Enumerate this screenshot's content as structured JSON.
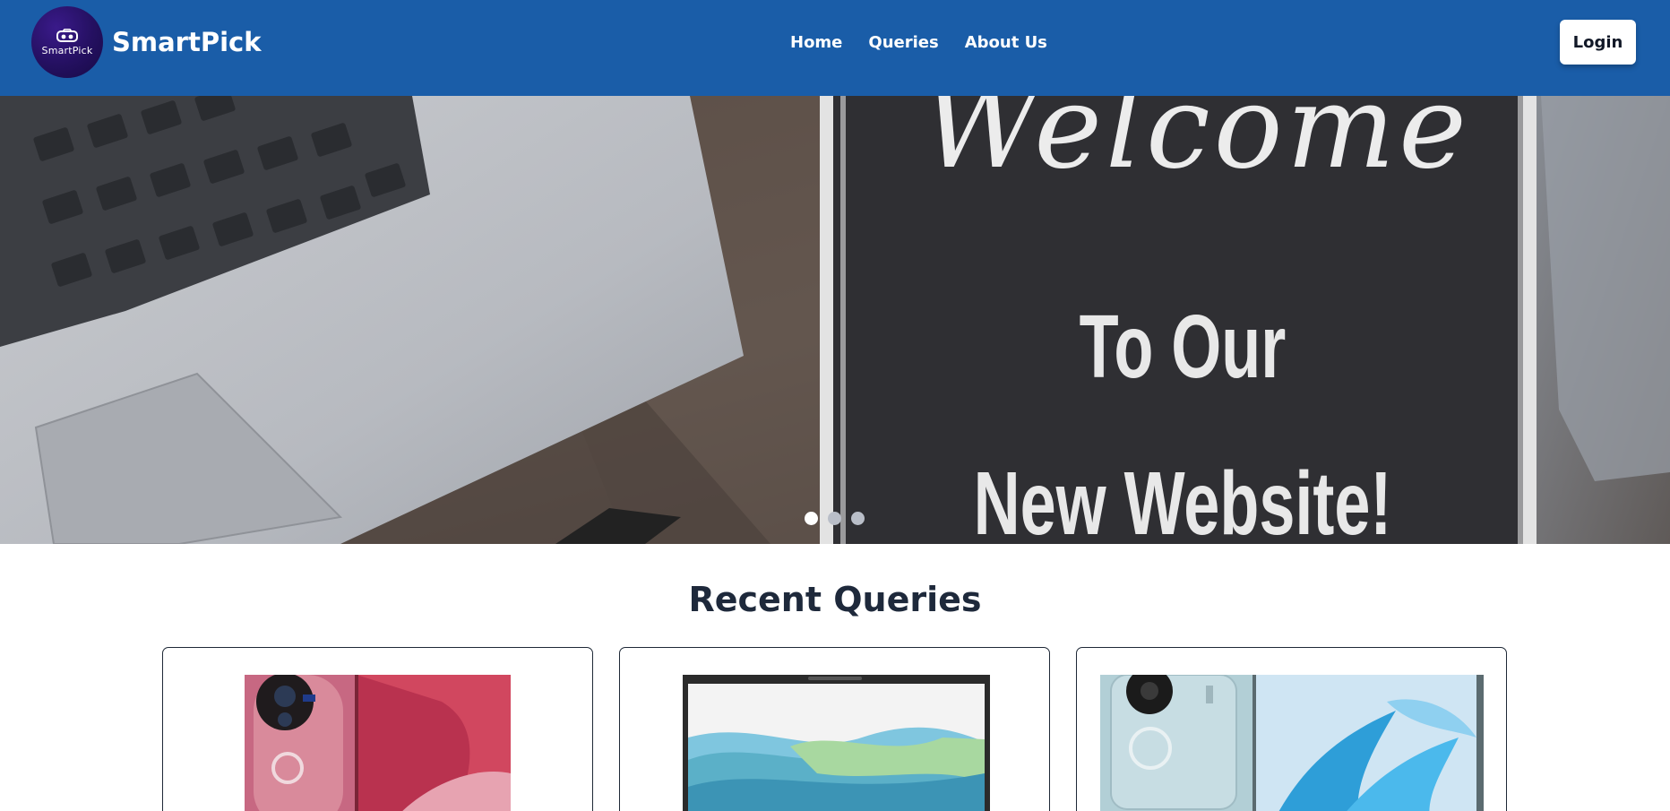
{
  "brand": {
    "logo_text": "SmartPick",
    "name": "SmartPick"
  },
  "nav": {
    "links": [
      {
        "label": "Home"
      },
      {
        "label": "Queries"
      },
      {
        "label": "About Us"
      }
    ],
    "login_label": "Login"
  },
  "hero": {
    "line1": "Welcome",
    "line2": "To Our",
    "line3": "New Website!",
    "slides_total": 3,
    "active_slide": 1
  },
  "recent": {
    "title": "Recent Queries",
    "cards": [
      {
        "image": "pink-smartphone-image"
      },
      {
        "image": "laptop-image"
      },
      {
        "image": "light-blue-smartphone-image"
      }
    ]
  },
  "colors": {
    "navbar": "#1a5da8",
    "logo": "#241060",
    "login_bg": "#ffffff",
    "dot_active": "#ffffff",
    "dot_inactive": "#b9bec8"
  }
}
